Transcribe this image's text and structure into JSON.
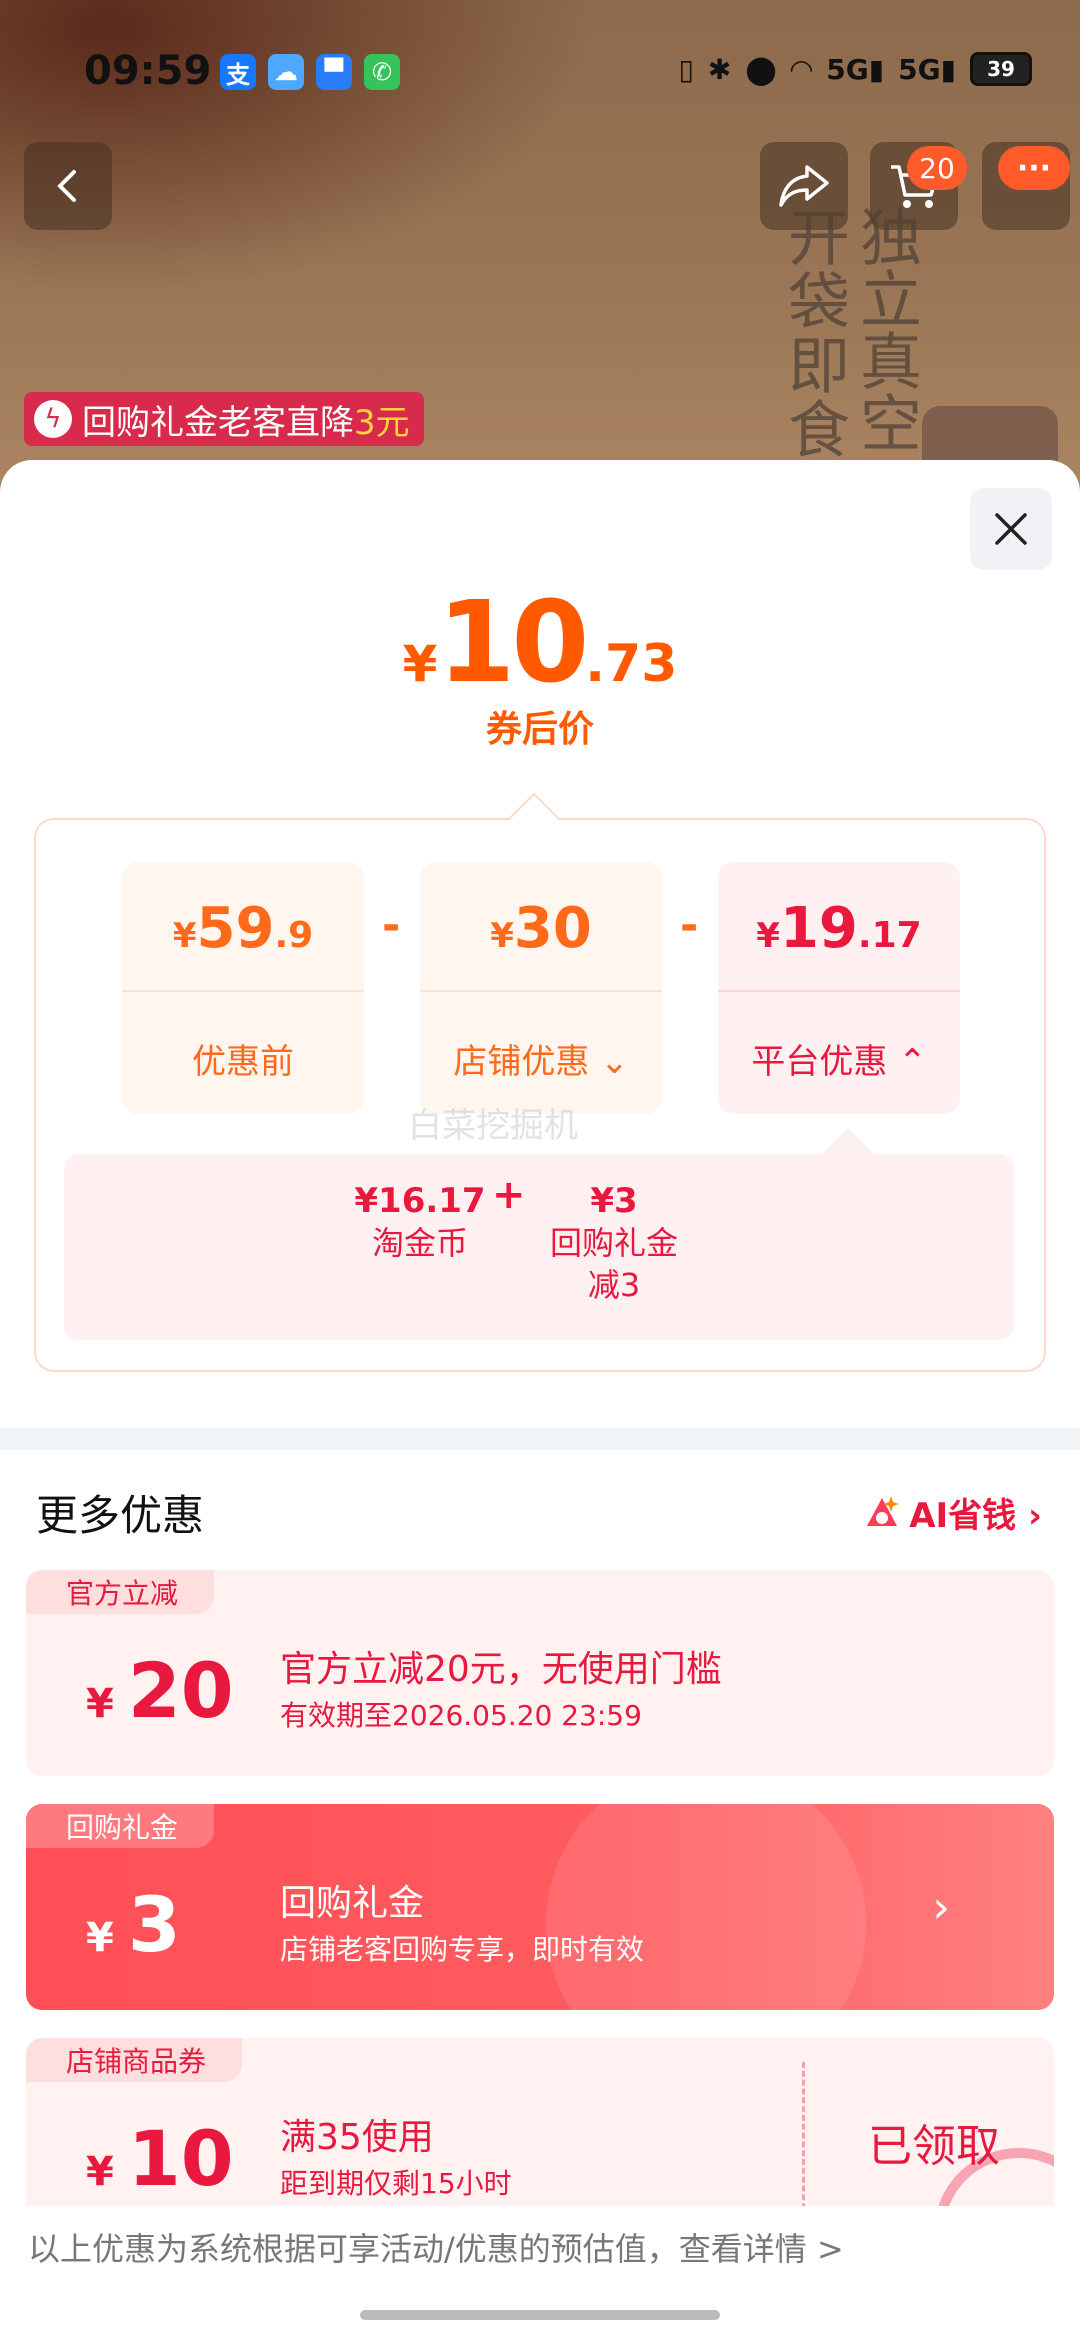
{
  "status_bar": {
    "time": "09:59",
    "battery": "39",
    "network_1": "5G",
    "network_2": "5G"
  },
  "product_page": {
    "cart_count": "20",
    "more_label": "···",
    "rebuy_banner": {
      "prefix": "回购礼金老客直降",
      "highlight": "3元"
    },
    "product_text_col1": "独立真空",
    "product_text_col2": "开袋即食"
  },
  "price_sheet": {
    "final_price": {
      "currency": "¥",
      "integer": "10",
      "decimal": ".73"
    },
    "final_label": "券后价",
    "cards": [
      {
        "currency": "¥",
        "integer": "59",
        "decimal": ".9",
        "label": "优惠前",
        "chevron": ""
      },
      {
        "currency": "¥",
        "integer": "30",
        "decimal": "",
        "label": "店铺优惠",
        "chevron": "⌄"
      },
      {
        "currency": "¥",
        "integer": "19",
        "decimal": ".17",
        "label": "平台优惠",
        "chevron": "⌃"
      }
    ],
    "minus_sign": "-",
    "watermark": "白菜挖掘机",
    "platform_breakdown": [
      {
        "value": "¥16.17",
        "label": "淘金币"
      },
      {
        "value": "¥3",
        "label": "回购礼金",
        "sublabel": "减3"
      }
    ],
    "plus_sign": "+"
  },
  "more_offers": {
    "title": "更多优惠",
    "ai_link": "AI省钱 ›",
    "coupons": [
      {
        "tag": "官方立减",
        "currency": "¥",
        "amount": "20",
        "title": "官方立减20元，无使用门槛",
        "subtitle": "有效期至2026.05.20 23:59"
      },
      {
        "tag": "回购礼金",
        "currency": "¥",
        "amount": "3",
        "title": "回购礼金",
        "subtitle": "店铺老客回购专享，即时有效",
        "arrow": "›"
      },
      {
        "tag": "店铺商品券",
        "currency": "¥",
        "amount": "10",
        "title": "满35使用",
        "subtitle": "距到期仅剩15小时",
        "status": "已领取"
      }
    ]
  },
  "footer_note": "以上优惠为系统根据可享活动/优惠的预估值，查看详情 >",
  "colors": {
    "accent_orange": "#ff5a00",
    "accent_red": "#e8183e",
    "coupon_red": "#ff4e56"
  }
}
